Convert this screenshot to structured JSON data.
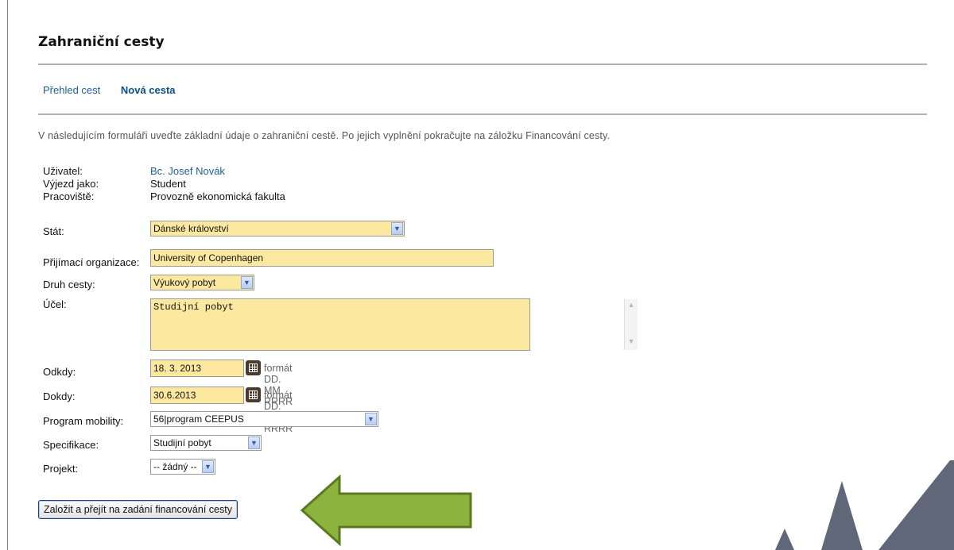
{
  "page": {
    "title": "Zahraniční cesty"
  },
  "tabs": [
    {
      "label": "Přehled cest",
      "active": false
    },
    {
      "label": "Nová cesta",
      "active": true
    }
  ],
  "intro": "V následujícím formuláři uveďte základní údaje o zahraniční cestě. Po jejich vyplnění pokračujte na záložku Financování cesty.",
  "form": {
    "uzivatel": {
      "label": "Uživatel:",
      "value": "Bc. Josef Novák"
    },
    "vyjezd": {
      "label": "Výjezd jako:",
      "value": "Student"
    },
    "pracoviste": {
      "label": "Pracoviště:",
      "value": "Provozně ekonomická fakulta"
    },
    "stat": {
      "label": "Stát:",
      "value": "Dánské království"
    },
    "organizace": {
      "label": "Přijímací organizace:",
      "value": "University of Copenhagen"
    },
    "druh": {
      "label": "Druh cesty:",
      "value": "Výukový pobyt"
    },
    "ucel": {
      "label": "Účel:",
      "value": "Studijní pobyt"
    },
    "odkdy": {
      "label": "Odkdy:",
      "value": "18. 3. 2013",
      "format": "formát DD. MM. RRRR"
    },
    "dokdy": {
      "label": "Dokdy:",
      "value": "30.6.2013",
      "format": "formát DD. MM. RRRR"
    },
    "program": {
      "label": "Program mobility:",
      "value": "56|program CEEPUS"
    },
    "specifikace": {
      "label": "Specifikace:",
      "value": "Studijní pobyt"
    },
    "projekt": {
      "label": "Projekt:",
      "value": "-- žádný --"
    }
  },
  "submit": {
    "label": "Založit a přejít na zadání financování cesty"
  },
  "colors": {
    "field_bg": "#fde8a0",
    "link": "#1f5f96",
    "arrow_fill": "#8db33f",
    "arrow_stroke": "#5b7a1f",
    "mountains": "#5f6778"
  },
  "icons": {
    "calendar": "calendar-icon",
    "dropdown": "chevron-down-icon",
    "annotation": "arrow-left-icon"
  }
}
